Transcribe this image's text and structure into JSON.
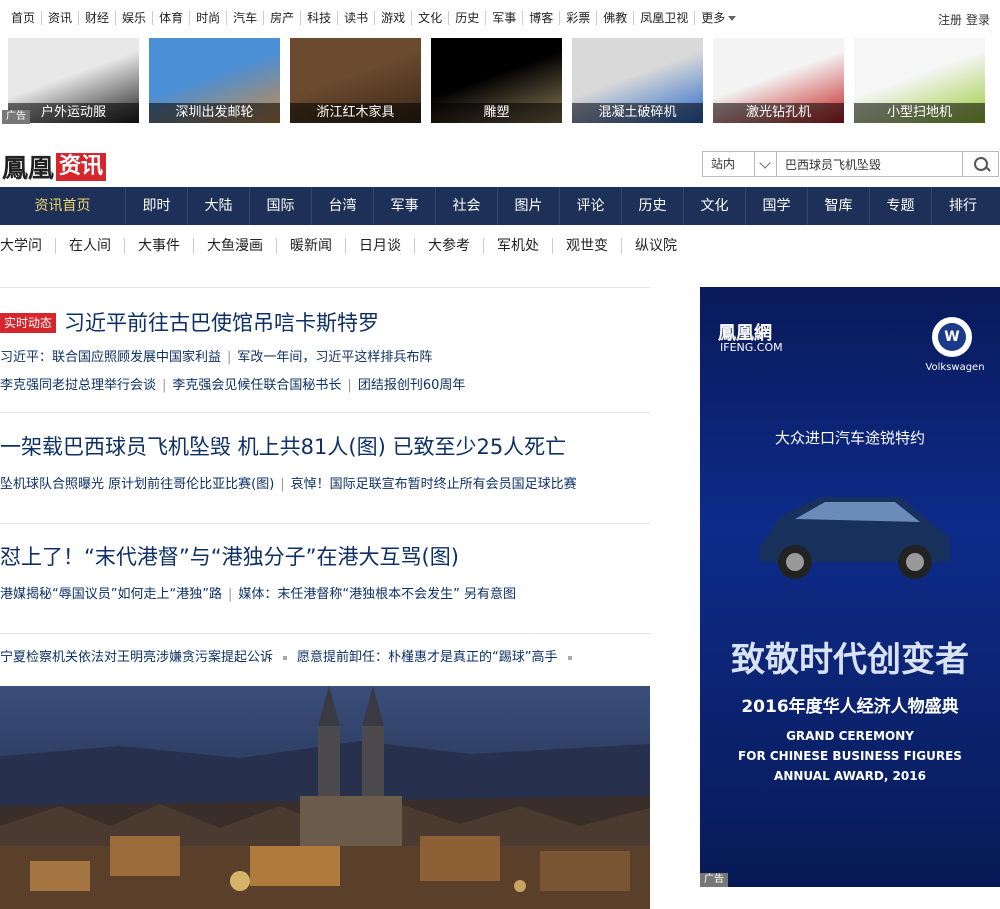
{
  "topnav": {
    "links": [
      "首页",
      "资讯",
      "财经",
      "娱乐",
      "体育",
      "时尚",
      "汽车",
      "房产",
      "科技",
      "读书",
      "游戏",
      "文化",
      "历史",
      "军事",
      "博客",
      "彩票",
      "佛教",
      "凤凰卫视"
    ],
    "more": "更多",
    "register": "注册",
    "login": "登录"
  },
  "ads": {
    "tag": "广告",
    "tiles": [
      "户外运动服",
      "深圳出发邮轮",
      "浙江红木家具",
      "雕塑",
      "混凝土破碎机",
      "激光钻孔机",
      "小型扫地机"
    ]
  },
  "logo": {
    "main": "鳳凰",
    "badge": "资讯"
  },
  "search": {
    "scope": "站内",
    "value": "巴西球员飞机坠毁"
  },
  "mainnav": [
    "资讯首页",
    "即时",
    "大陆",
    "国际",
    "台湾",
    "军事",
    "社会",
    "图片",
    "评论",
    "历史",
    "文化",
    "国学",
    "智库",
    "专题",
    "排行"
  ],
  "subnav": [
    "大学问",
    "在人间",
    "大事件",
    "大鱼漫画",
    "暖新闻",
    "日月谈",
    "大参考",
    "军机处",
    "观世变",
    "纵议院"
  ],
  "news": {
    "tag": "实时动态",
    "h1": "习近平前往古巴使馆吊唁卡斯特罗",
    "h1_links_row1": [
      "习近平：联合国应照顾发展中国家利益",
      "军改一年间，习近平这样排兵布阵"
    ],
    "h1_links_row2": [
      "李克强同老挝总理举行会谈",
      "李克强会见候任联合国秘书长",
      "团结报创刊60周年"
    ],
    "h2": "一架载巴西球员飞机坠毁 机上共81人(图) 已致至少25人死亡",
    "h2_links": [
      "坠机球队合照曝光 原计划前往哥伦比亚比赛(图)",
      "哀悼！国际足联宣布暂时终止所有会员国足球比赛"
    ],
    "h3": "怼上了！“末代港督”与“港独分子”在港大互骂(图)",
    "h3_links": [
      "港媒揭秘“辱国议员”如何走上“港独”路",
      "媒体：末任港督称“港独根本不会发生” 另有意图"
    ],
    "ticker": [
      "宁夏检察机关依法对王明亮涉嫌贪污案提起公诉",
      "愿意提前卸任：朴槿惠才是真正的“踢球”高手"
    ]
  },
  "bigad": {
    "brand": "鳳凰網",
    "brand_en": "IFENG.COM",
    "vw": "Volkswagen",
    "slogan": "大众进口汽车途锐特约",
    "main": "致敬时代创变者",
    "sub": "2016年度华人经济人物盛典",
    "en1": "GRAND CEREMONY",
    "en2": "FOR CHINESE BUSINESS FIGURES",
    "en3": "ANNUAL AWARD, 2016",
    "tag": "广告"
  }
}
